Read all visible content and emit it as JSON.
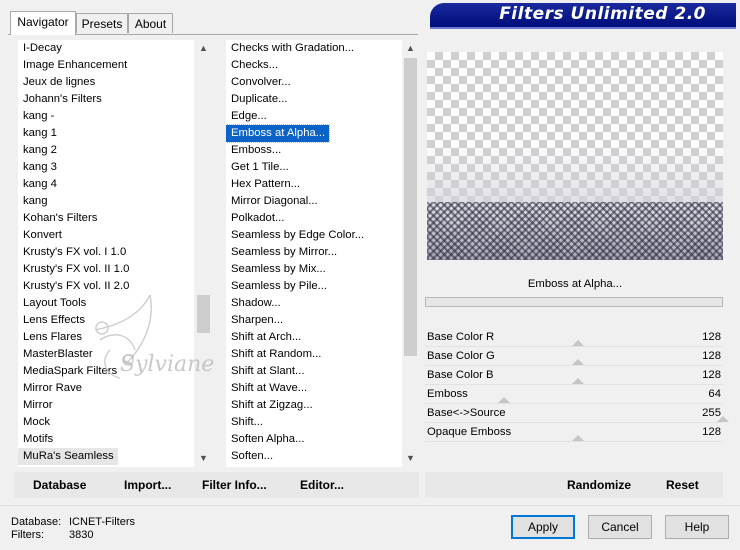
{
  "tabs": [
    {
      "label": "Navigator",
      "active": true
    },
    {
      "label": "Presets",
      "active": false
    },
    {
      "label": "About",
      "active": false
    }
  ],
  "title": "Filters Unlimited 2.0",
  "categories": {
    "items": [
      "I-Decay",
      "Image Enhancement",
      "Jeux de lignes",
      "Johann's Filters",
      "kang -",
      "kang 1",
      "kang 2",
      "kang 3",
      "kang 4",
      "kang",
      "Kohan's Filters",
      "Konvert",
      "Krusty's FX vol. I 1.0",
      "Krusty's FX vol. II 1.0",
      "Krusty's FX vol. II 2.0",
      "Layout Tools",
      "Lens Effects",
      "Lens Flares",
      "MasterBlaster",
      "MediaSpark Filters",
      "Mirror Rave",
      "Mirror",
      "Mock",
      "Motifs",
      "MuRa's Seamless"
    ],
    "highlighted_index": 24
  },
  "filters": {
    "items": [
      "Checks with Gradation...",
      "Checks...",
      "Convolver...",
      "Duplicate...",
      "Edge...",
      "Emboss at Alpha...",
      "Emboss...",
      "Get 1 Tile...",
      "Hex Pattern...",
      "Mirror Diagonal...",
      "Polkadot...",
      "Seamless by Edge Color...",
      "Seamless by Mirror...",
      "Seamless by Mix...",
      "Seamless by Pile...",
      "Shadow...",
      "Sharpen...",
      "Shift at Arch...",
      "Shift at Random...",
      "Shift at Slant...",
      "Shift at Wave...",
      "Shift at Zigzag...",
      "Shift...",
      "Soften Alpha...",
      "Soften..."
    ],
    "selected_index": 5
  },
  "selected_filter_name": "Emboss at Alpha...",
  "progress": 0,
  "parameters": [
    {
      "label": "Base Color R",
      "value": 128
    },
    {
      "label": "Base Color G",
      "value": 128
    },
    {
      "label": "Base Color B",
      "value": 128
    },
    {
      "label": "Emboss",
      "value": 64
    },
    {
      "label": "Base<->Source",
      "value": 255
    },
    {
      "label": "Opaque Emboss",
      "value": 128
    }
  ],
  "left_buttons": [
    {
      "label": "Database"
    },
    {
      "label": "Import..."
    },
    {
      "label": "Filter Info..."
    },
    {
      "label": "Editor..."
    }
  ],
  "right_buttons": [
    {
      "label": "Randomize"
    },
    {
      "label": "Reset"
    }
  ],
  "status": {
    "database_label": "Database:",
    "database_value": "ICNET-Filters",
    "filters_label": "Filters:",
    "filters_value": "3830"
  },
  "dialog_buttons": {
    "apply": "Apply",
    "cancel": "Cancel",
    "help": "Help"
  },
  "watermark": "Sylviane",
  "icons": {
    "scroll_up": "chevron-up-icon",
    "scroll_down": "chevron-down-icon"
  },
  "colors": {
    "banner": "#0a1a8e",
    "selection": "#0b62c8",
    "default_button_border": "#0078d7"
  }
}
